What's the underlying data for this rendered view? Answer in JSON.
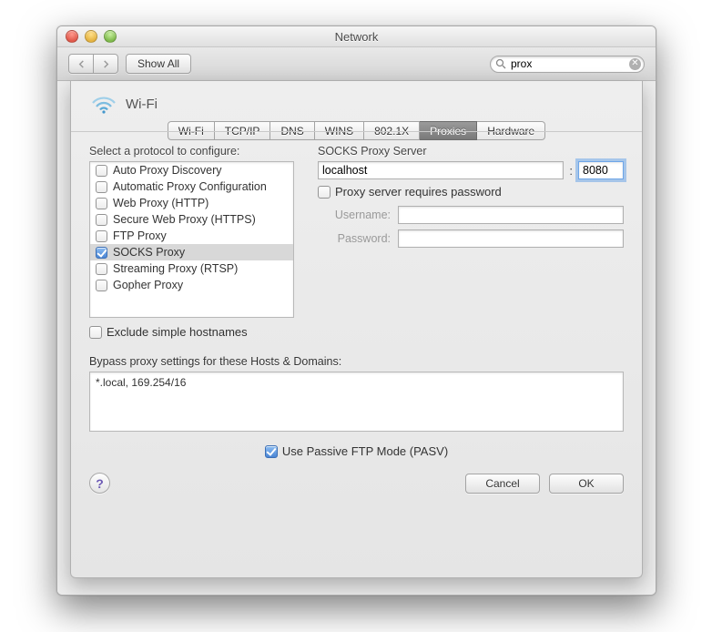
{
  "window": {
    "title": "Network"
  },
  "toolbar": {
    "show_all": "Show All",
    "search_value": "prox"
  },
  "header": {
    "connection": "Wi-Fi"
  },
  "tabs": [
    {
      "label": "Wi-Fi",
      "selected": false
    },
    {
      "label": "TCP/IP",
      "selected": false
    },
    {
      "label": "DNS",
      "selected": false
    },
    {
      "label": "WINS",
      "selected": false
    },
    {
      "label": "802.1X",
      "selected": false
    },
    {
      "label": "Proxies",
      "selected": true
    },
    {
      "label": "Hardware",
      "selected": false
    }
  ],
  "left": {
    "heading": "Select a protocol to configure:",
    "protocols": [
      {
        "label": "Auto Proxy Discovery",
        "checked": false,
        "selected": false
      },
      {
        "label": "Automatic Proxy Configuration",
        "checked": false,
        "selected": false
      },
      {
        "label": "Web Proxy (HTTP)",
        "checked": false,
        "selected": false
      },
      {
        "label": "Secure Web Proxy (HTTPS)",
        "checked": false,
        "selected": false
      },
      {
        "label": "FTP Proxy",
        "checked": false,
        "selected": false
      },
      {
        "label": "SOCKS Proxy",
        "checked": true,
        "selected": true
      },
      {
        "label": "Streaming Proxy (RTSP)",
        "checked": false,
        "selected": false
      },
      {
        "label": "Gopher Proxy",
        "checked": false,
        "selected": false
      }
    ],
    "exclude_simple_label": "Exclude simple hostnames",
    "exclude_simple_checked": false
  },
  "right": {
    "heading": "SOCKS Proxy Server",
    "host": "localhost",
    "port": "8080",
    "requires_password_label": "Proxy server requires password",
    "requires_password_checked": false,
    "username_label": "Username:",
    "password_label": "Password:",
    "username": "",
    "password": ""
  },
  "bypass": {
    "label": "Bypass proxy settings for these Hosts & Domains:",
    "value": "*.local, 169.254/16"
  },
  "pasv": {
    "label": "Use Passive FTP Mode (PASV)",
    "checked": true
  },
  "footer": {
    "cancel": "Cancel",
    "ok": "OK"
  }
}
